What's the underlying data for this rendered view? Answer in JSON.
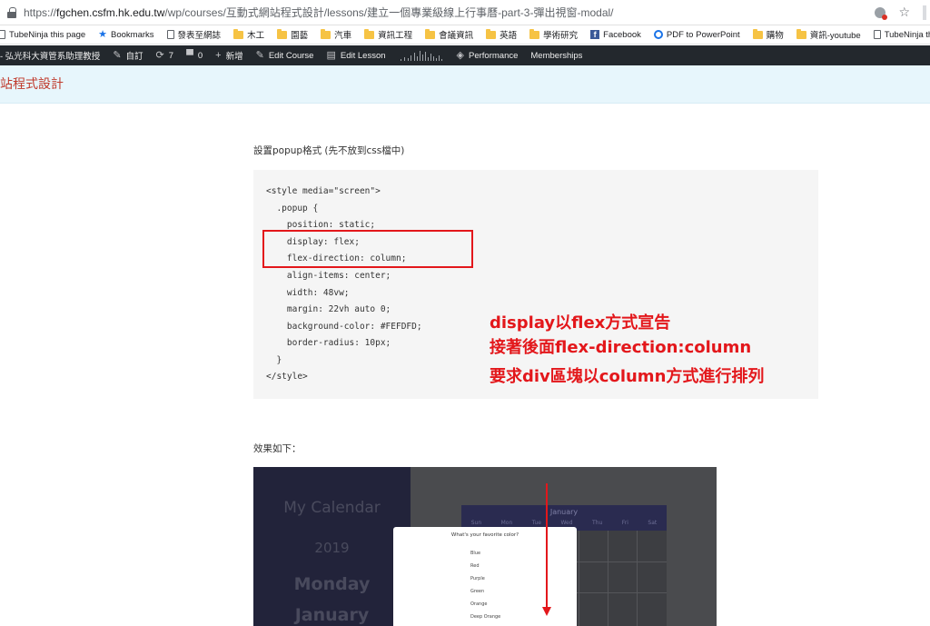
{
  "browser": {
    "url_prefix": "https://",
    "url_host": "fgchen.csfm.hk.edu.tw",
    "url_path": "/wp/courses/互動式網站程式設計/lessons/建立一個專業級線上行事曆-part-3-彈出視窗-modal/"
  },
  "bookmarks": [
    {
      "label": "TubeNinja this page",
      "icon": "page-icon"
    },
    {
      "label": "Bookmarks",
      "icon": "star-icon"
    },
    {
      "label": "發表至網誌",
      "icon": "page-icon"
    },
    {
      "label": "木工",
      "icon": "folder-icon"
    },
    {
      "label": "園藝",
      "icon": "folder-icon"
    },
    {
      "label": "汽車",
      "icon": "folder-icon"
    },
    {
      "label": "資訊工程",
      "icon": "folder-icon"
    },
    {
      "label": "會議資訊",
      "icon": "folder-icon"
    },
    {
      "label": "英語",
      "icon": "folder-icon"
    },
    {
      "label": "學術研究",
      "icon": "folder-icon"
    },
    {
      "label": "Facebook",
      "icon": "facebook-icon"
    },
    {
      "label": "PDF to PowerPoint",
      "icon": "pdf-icon"
    },
    {
      "label": "購物",
      "icon": "folder-icon"
    },
    {
      "label": "資訊-youtube",
      "icon": "folder-icon"
    },
    {
      "label": "TubeNinja this page",
      "icon": "page-icon"
    }
  ],
  "adminbar": {
    "site": "- 弘光科大資管系助理教授",
    "customize": "自訂",
    "updates_count": "7",
    "comments_count": "0",
    "new": "新增",
    "edit_course": "Edit Course",
    "edit_lesson": "Edit Lesson",
    "performance": "Performance",
    "memberships": "Memberships"
  },
  "site_title": "站程式設計",
  "content": {
    "intro": "設置popup格式 (先不放到css檔中)",
    "code_lines": [
      "<style media=\"screen\">",
      "  .popup {",
      "    position: static;",
      "    display: flex;",
      "    flex-direction: column;",
      "    align-items: center;",
      "    width: 48vw;",
      "    margin: 22vh auto 0;",
      "    background-color: #FEFDFD;",
      "    border-radius: 10px;",
      "  }",
      "</style>"
    ],
    "annotation_lines": [
      "display以flex方式宣告",
      "接著後面flex-direction:column",
      "要求div區塊以column方式進行排列"
    ],
    "result_label": "效果如下："
  },
  "demo": {
    "calendar_title": "My Calendar",
    "year": "2019",
    "day": "Monday",
    "month": "January",
    "grid_month": "January",
    "weekdays": [
      "Sun",
      "Mon",
      "Tue",
      "Wed",
      "Thu",
      "Fri",
      "Sat"
    ],
    "popup_question": "What's your favorite color?",
    "popup_options": [
      "Blue",
      "Red",
      "Purple",
      "Green",
      "Orange",
      "Deep Orange"
    ]
  },
  "colors": {
    "accent_red": "#e3171b",
    "site_title": "#c0392b",
    "adminbar": "#23282d"
  }
}
